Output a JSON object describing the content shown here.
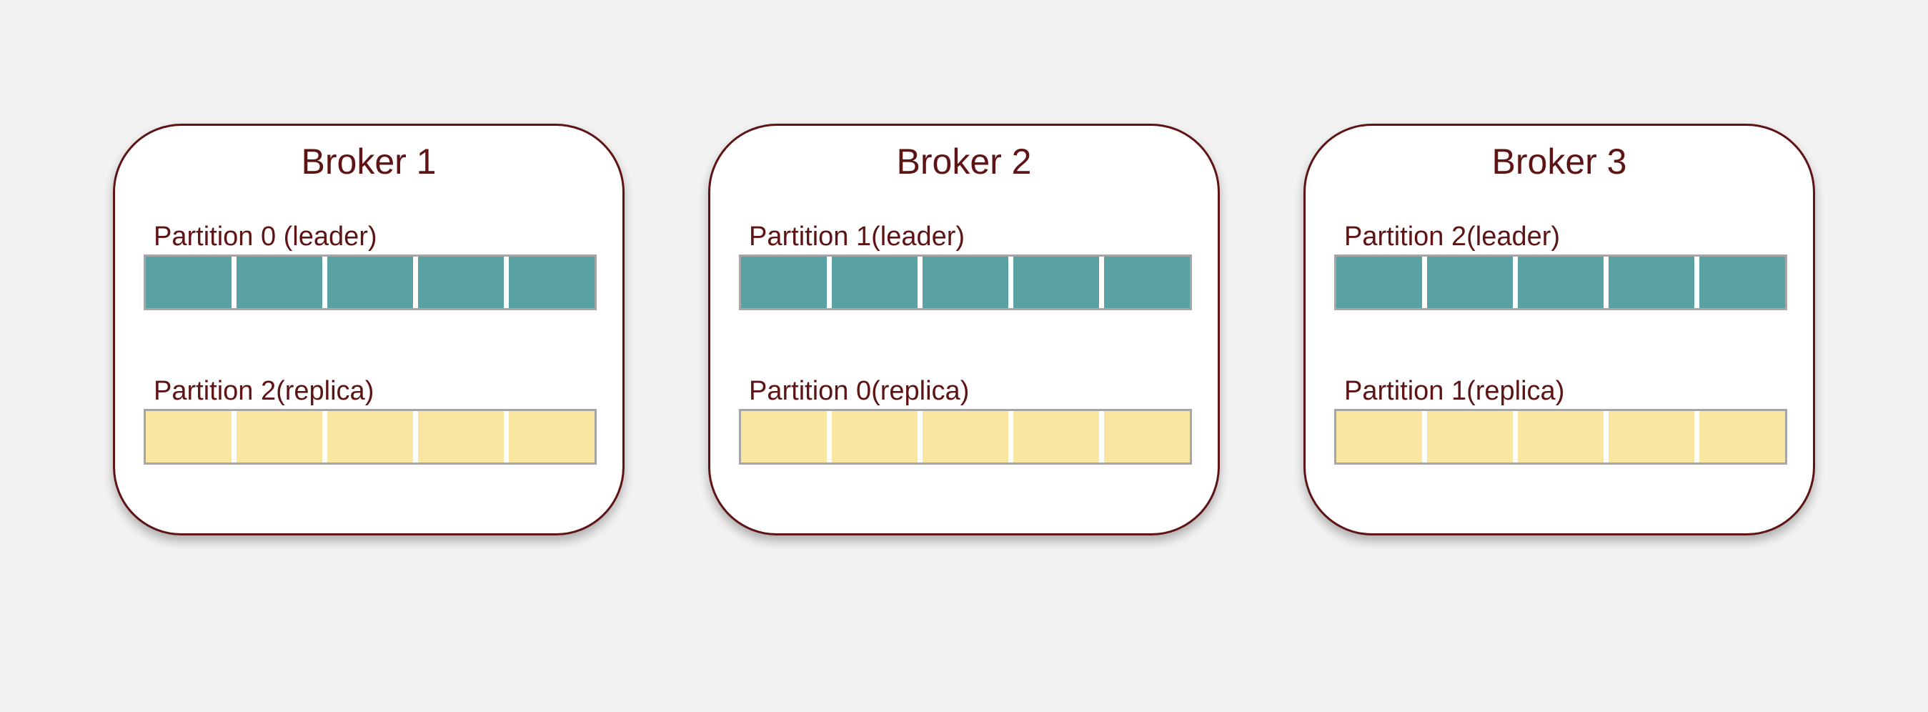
{
  "colors": {
    "background": "#f2f2f2",
    "broker_border": "#5e1414",
    "text": "#5e1414",
    "leader_fill": "#5aa1a3",
    "replica_fill": "#fae5a1",
    "bar_border": "#a6a6a6"
  },
  "brokers": [
    {
      "title": "Broker 1",
      "leader": {
        "label": "Partition 0 (leader)",
        "segments": 5
      },
      "replica": {
        "label": "Partition 2(replica)",
        "segments": 5
      }
    },
    {
      "title": "Broker 2",
      "leader": {
        "label": "Partition 1(leader)",
        "segments": 5
      },
      "replica": {
        "label": "Partition 0(replica)",
        "segments": 5
      }
    },
    {
      "title": "Broker 3",
      "leader": {
        "label": "Partition 2(leader)",
        "segments": 5
      },
      "replica": {
        "label": "Partition 1(replica)",
        "segments": 5
      }
    }
  ]
}
